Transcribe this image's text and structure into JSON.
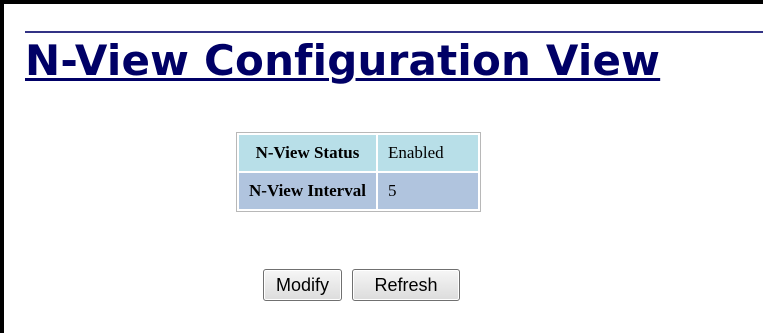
{
  "page": {
    "title": "N-View Configuration View"
  },
  "settings": {
    "rows": [
      {
        "label": "N-View Status",
        "value": "Enabled"
      },
      {
        "label": "N-View Interval",
        "value": "5"
      }
    ]
  },
  "actions": {
    "modify_label": "Modify",
    "refresh_label": "Refresh"
  },
  "colors": {
    "title": "#000066",
    "status_row_bg": "#b8dfe8",
    "interval_row_bg": "#b0c4de"
  }
}
